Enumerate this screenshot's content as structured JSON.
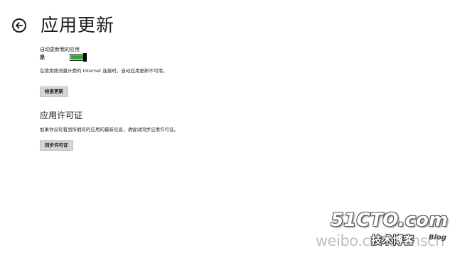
{
  "header": {
    "back_icon": "arrow-left-circle-icon",
    "title": "应用更新"
  },
  "auto_update": {
    "label": "自动更新我的应用",
    "state_text": "是",
    "enabled": true,
    "accent_color": "#2fa62f",
    "note": "在使用按流量计费的 Internet 连接时，自动应用更新不可用。"
  },
  "buttons": {
    "check_updates": "检查更新",
    "sync_licenses": "同步许可证"
  },
  "license": {
    "title": "应用许可证",
    "note": "如果你没有看到所拥有的应用的最新信息，请尝试同步应用许可证。"
  },
  "watermark": {
    "site": "51CTO.com",
    "cn": "技术博客",
    "blog": "Blog",
    "weibo": "weibo.com/...nsch"
  }
}
